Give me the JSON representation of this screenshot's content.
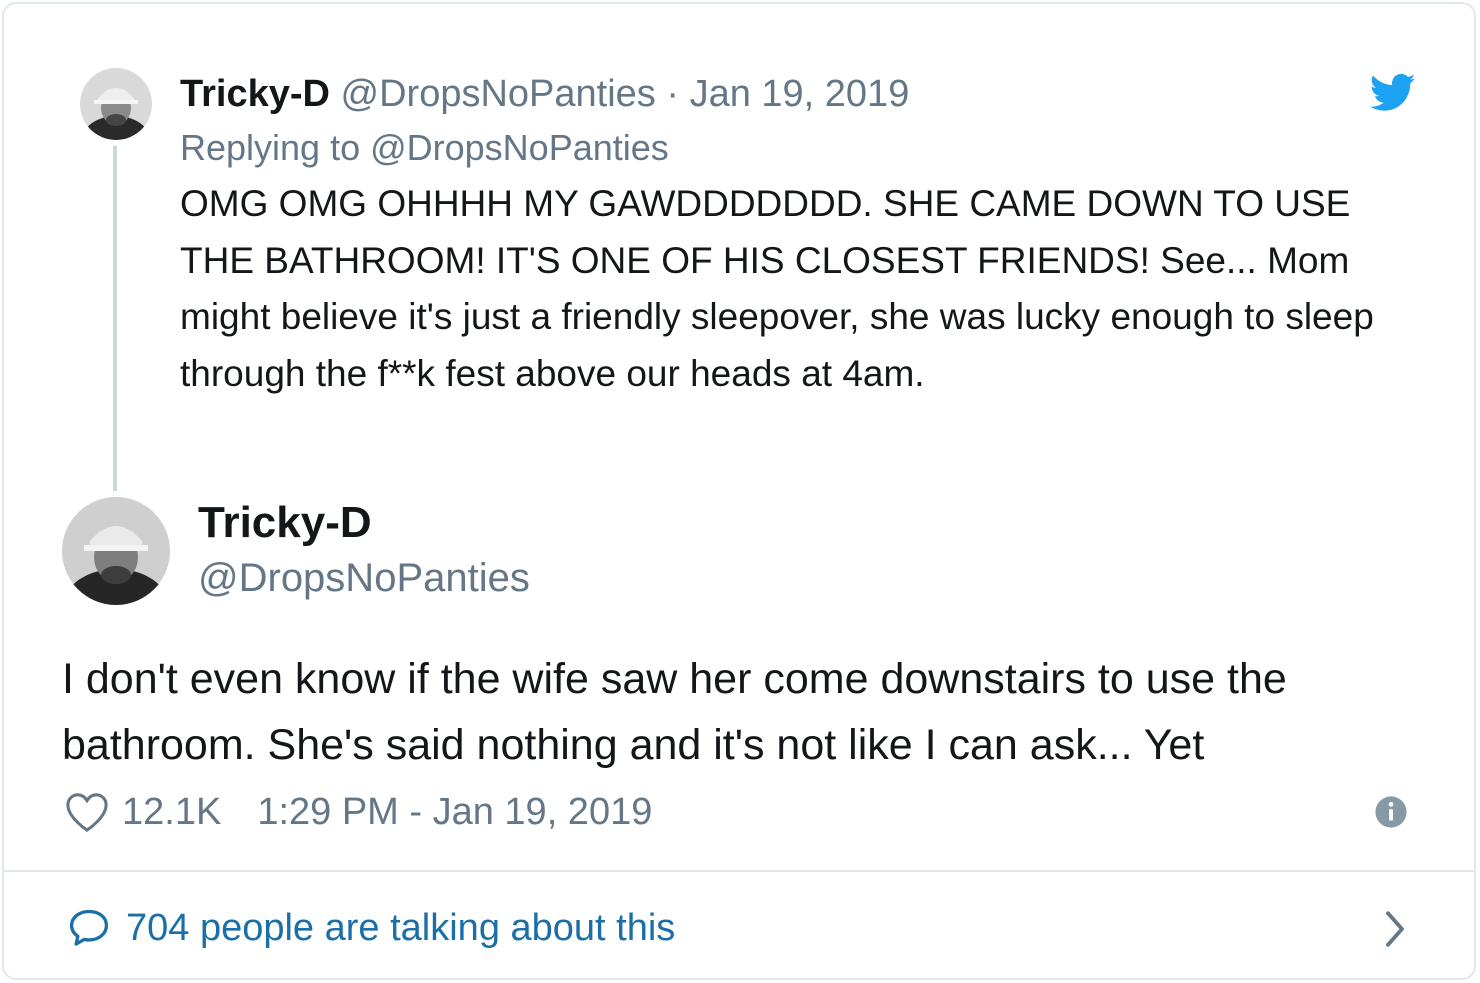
{
  "parent_tweet": {
    "name": "Tricky-D",
    "handle": "@DropsNoPanties",
    "separator": " · ",
    "date": "Jan 19, 2019",
    "replying_prefix": "Replying to ",
    "replying_handle": "@DropsNoPanties",
    "text": "OMG OMG OHHHH MY GAWDDDDDDD. SHE CAME DOWN TO USE THE BATHROOM! IT'S ONE OF HIS CLOSEST FRIENDS! See... Mom might believe it's just a friendly sleepover, she was lucky enough to sleep through the f**k fest above our heads at 4am."
  },
  "main_tweet": {
    "name": "Tricky-D",
    "handle": "@DropsNoPanties",
    "text": "I don't even know if the wife saw her come downstairs to use the bathroom. She's said nothing and it's not like I can ask... Yet",
    "likes": "12.1K",
    "timestamp": "1:29 PM - Jan 19, 2019"
  },
  "footer": {
    "talking_text": "704 people are talking about this"
  },
  "icons": {
    "brand": "twitter-bird-icon",
    "like": "heart-icon",
    "info": "info-icon",
    "reply": "speech-bubble-icon",
    "chevron": "chevron-right-icon"
  },
  "colors": {
    "twitter_blue": "#1da1f2",
    "link_blue": "#1b6fa8",
    "gray": "#657786",
    "border": "#e1e8ed"
  }
}
